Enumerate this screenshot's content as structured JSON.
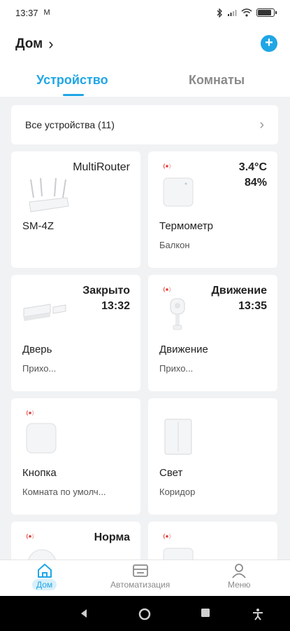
{
  "statusbar": {
    "time": "13:37",
    "notif_icon": "M",
    "battery_level": 0.85
  },
  "header": {
    "home_label": "Дом",
    "home_chevron": "›",
    "add_label": "+"
  },
  "tabs": {
    "devices": "Устройство",
    "rooms": "Комнаты"
  },
  "all_devices": {
    "label": "Все устройства (11)",
    "chevron": "›"
  },
  "cards": [
    {
      "status": "MultiRouter",
      "name": "SM-4Z",
      "room": ""
    },
    {
      "status_line1": "3.4°C",
      "status_line2": "84%",
      "name": "Термометр",
      "room": "Балкон"
    },
    {
      "status_line1": "Закрыто",
      "status_line2": "13:32",
      "name": "Дверь",
      "room": "Прихо..."
    },
    {
      "status_line1": "Движение",
      "status_line2": "13:35",
      "name": "Движение",
      "room": "Прихо..."
    },
    {
      "status": "",
      "name": "Кнопка",
      "room": "Комната по умолч..."
    },
    {
      "status": "",
      "name": "Свет",
      "room": "Коридор"
    },
    {
      "status": "Норма",
      "name": "",
      "room": ""
    },
    {
      "status": "",
      "name": "",
      "room": ""
    }
  ],
  "nav": {
    "home": "Дом",
    "automation": "Автоматизация",
    "menu": "Меню"
  },
  "colors": {
    "accent": "#1fa6e6",
    "signal": "#e53935"
  }
}
